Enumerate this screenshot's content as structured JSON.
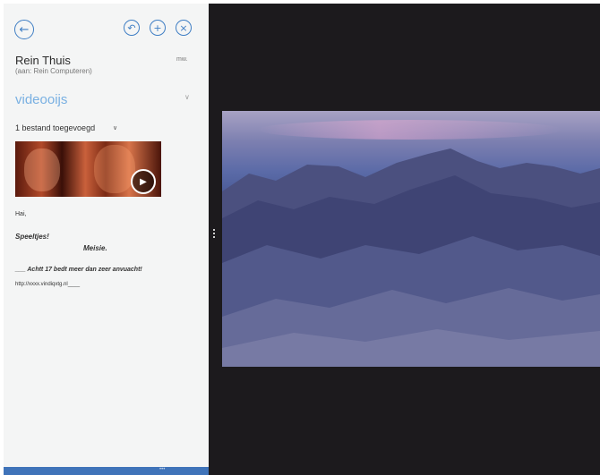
{
  "toolbar": {
    "back_icon": "arrow-left-icon",
    "reply_icon": "reply-icon",
    "add_icon": "plus-icon",
    "delete_icon": "close-icon",
    "accent": "#3f7ec4"
  },
  "message": {
    "sender": "Rein Thuis",
    "sender_sub": "(aan: Rein Computeren)",
    "time": "mw.",
    "subject": "videooijs",
    "attachment_label": "1 bestand toegevoegd",
    "lines": [
      "Hai,",
      "Speeltjes!",
      "Meisie.",
      "___ Achtt 17 bedt meer dan zeer anvuacht!",
      "http://xxxx.vindiqxtg.nl____"
    ]
  },
  "colors": {
    "pane_bg": "#f4f5f5",
    "bottom_bar": "#3f73b9",
    "viewer_bg": "#1c1a1d",
    "subject": "#79b0e2"
  }
}
